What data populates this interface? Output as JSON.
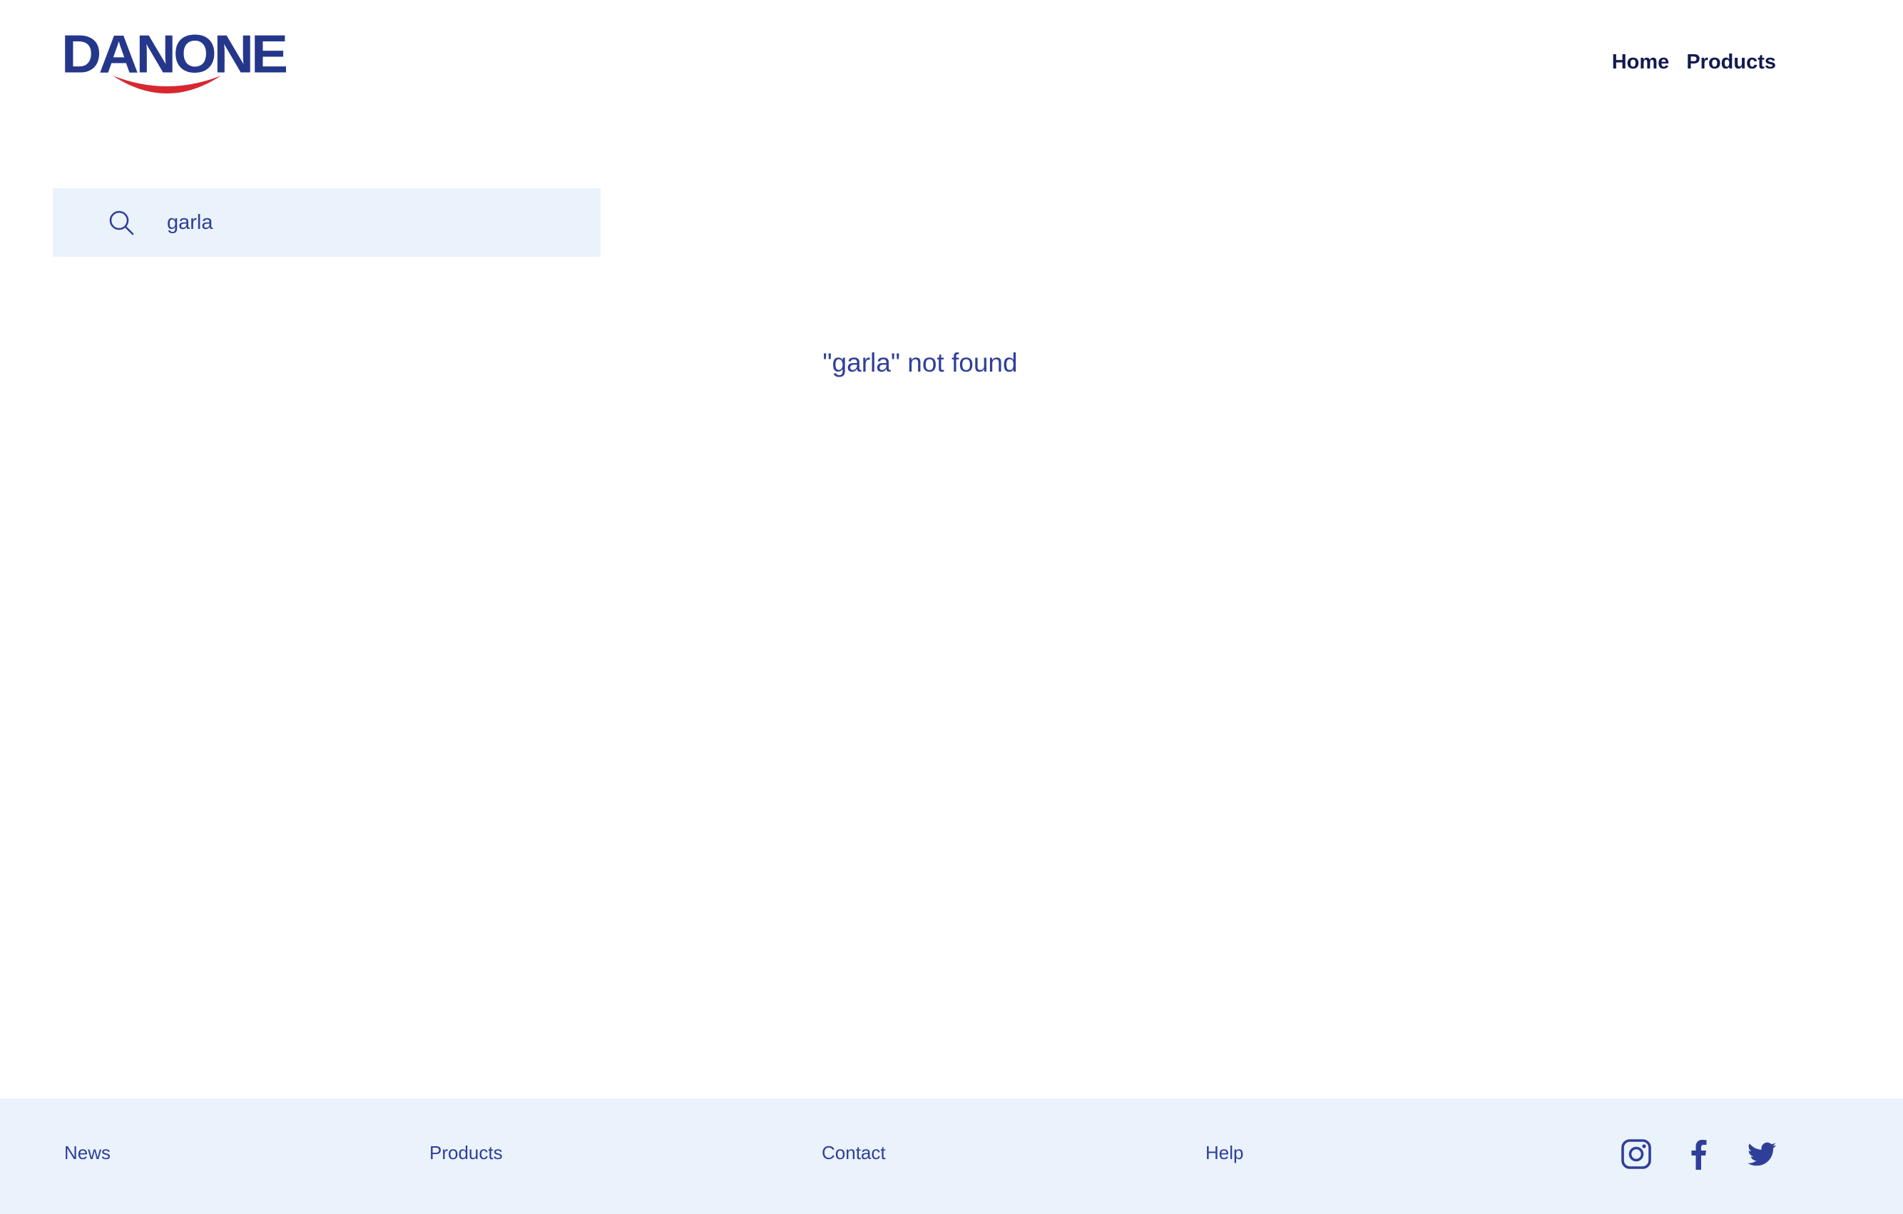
{
  "header": {
    "logo_text": "DANONE",
    "nav": [
      {
        "label": "Home"
      },
      {
        "label": "Products"
      }
    ]
  },
  "search": {
    "value": "garla",
    "icon": "search-icon"
  },
  "results": {
    "message": "\"garla\" not found"
  },
  "footer": {
    "links": [
      {
        "label": "News"
      },
      {
        "label": "Products"
      },
      {
        "label": "Contact"
      },
      {
        "label": "Help"
      }
    ],
    "social": [
      {
        "icon": "instagram-icon"
      },
      {
        "icon": "facebook-icon"
      },
      {
        "icon": "twitter-icon"
      }
    ]
  },
  "colors": {
    "brand_blue": "#2F3F99",
    "nav_dark": "#121A4E",
    "search_bg": "#EAF2FC",
    "footer_bg": "#EAF2FC",
    "smile_red": "#D7282F"
  }
}
